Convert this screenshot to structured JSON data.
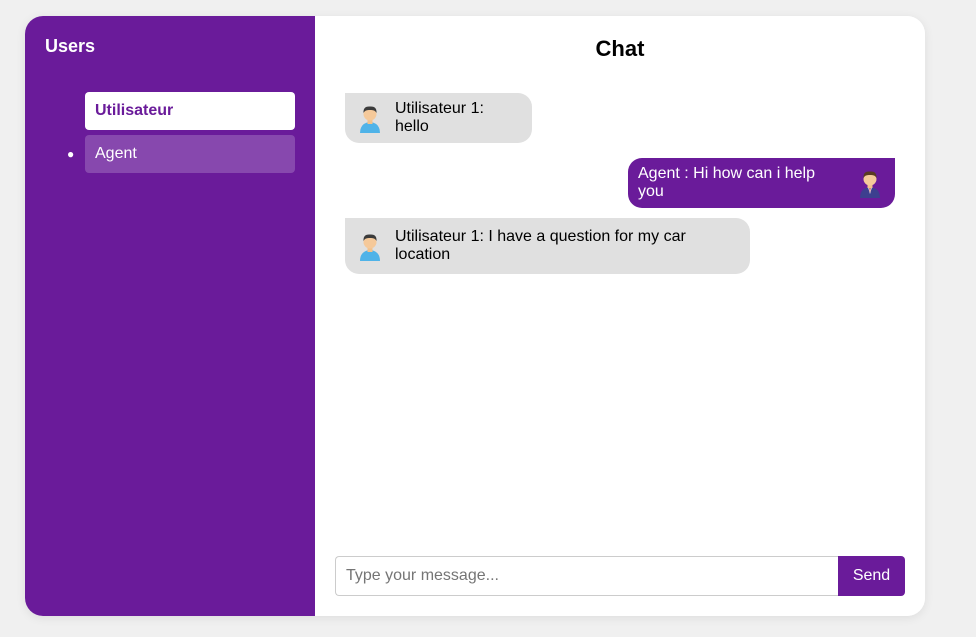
{
  "sidebar": {
    "title": "Users",
    "items": [
      {
        "label": "Utilisateur",
        "active": true
      },
      {
        "label": "Agent",
        "active": false
      }
    ]
  },
  "chat": {
    "title": "Chat",
    "messages": [
      {
        "from": "user",
        "text": "Utilisateur 1: hello",
        "avatar": "user-avatar-icon"
      },
      {
        "from": "agent",
        "text": "Agent : Hi how can i help you",
        "avatar": "agent-avatar-icon"
      },
      {
        "from": "user",
        "text": "Utilisateur 1: I have a question for my car location",
        "avatar": "user-avatar-icon"
      }
    ]
  },
  "composer": {
    "placeholder": "Type your message...",
    "value": "",
    "send_label": "Send"
  },
  "colors": {
    "accent": "#6a1b9a",
    "user_bubble": "#e0e0e0",
    "background": "#f0f0f0"
  }
}
